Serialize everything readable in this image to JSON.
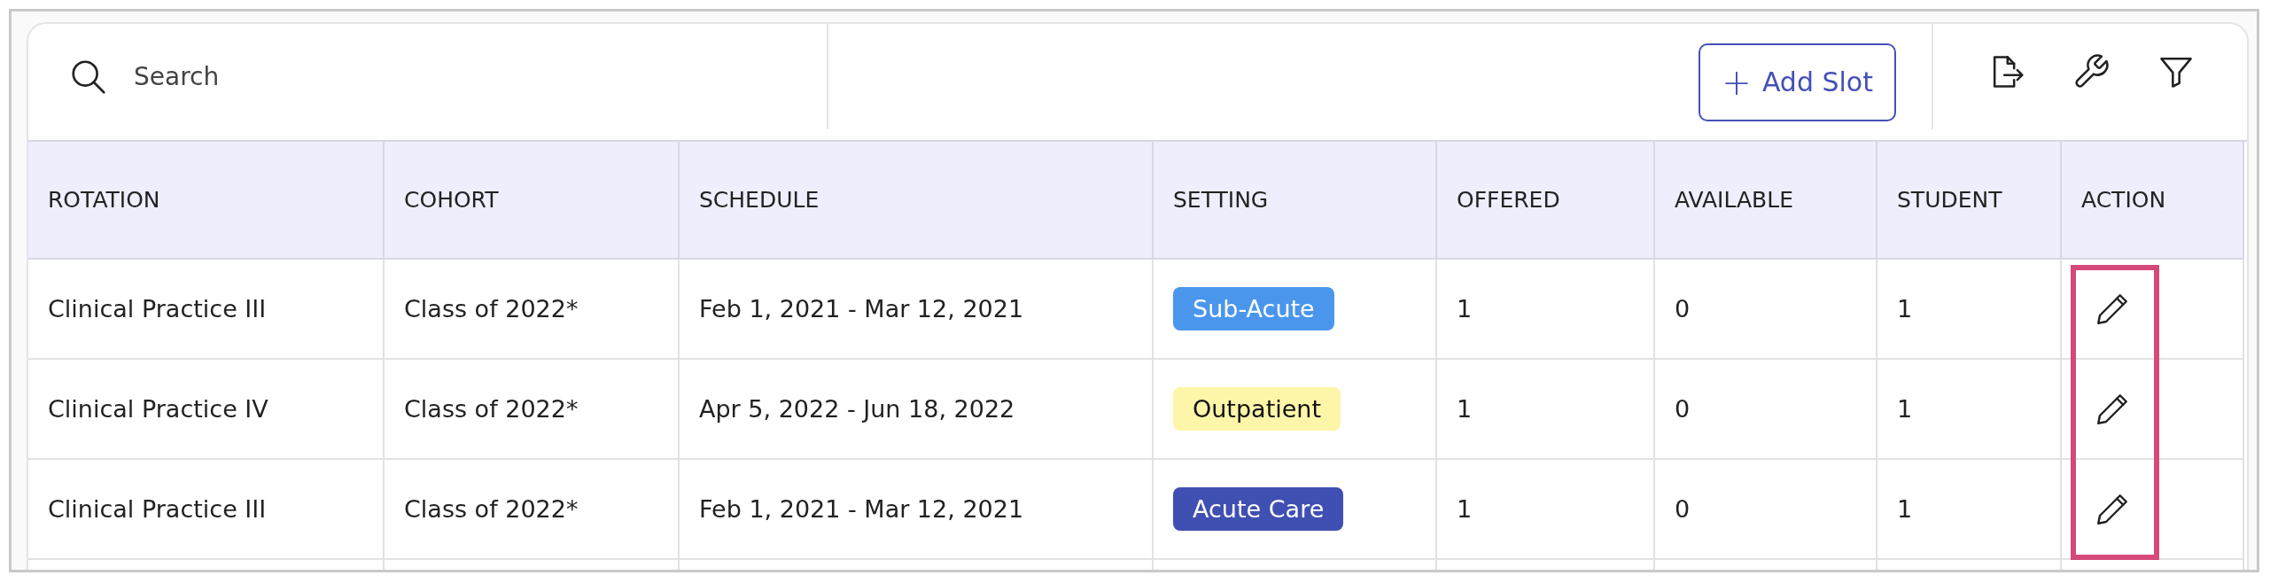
{
  "toolbar": {
    "search": {
      "placeholder": "Search"
    },
    "add_button": {
      "icon": "+",
      "label": "Add Slot"
    }
  },
  "table": {
    "columns": [
      "ROTATION",
      "COHORT",
      "SCHEDULE",
      "SETTING",
      "OFFERED",
      "AVAILABLE",
      "STUDENT",
      "ACTION"
    ],
    "rows": [
      {
        "rotation": "Clinical Practice III",
        "cohort": "Class of 2022*",
        "schedule": "Feb 1, 2021 - Mar 12, 2021",
        "setting": {
          "label": "Sub-Acute",
          "color": "#4a96ec"
        },
        "offered": "1",
        "available": "0",
        "students": "1"
      },
      {
        "rotation": "Clinical Practice IV",
        "cohort": "Class of 2022*",
        "schedule": "Apr 5, 2022 - Jun 18, 2022",
        "setting": {
          "label": "Outpatient",
          "color": "#fdf5a8"
        },
        "offered": "1",
        "available": "0",
        "students": "1"
      },
      {
        "rotation": "Clinical Practice III",
        "cohort": "Class of 2022*",
        "schedule": "Feb 1, 2021 - Mar 12, 2021",
        "setting": {
          "label": "Acute Care",
          "color": "#3f4fb2"
        },
        "offered": "1",
        "available": "0",
        "students": "1"
      }
    ],
    "action_column_highlighted": true
  }
}
